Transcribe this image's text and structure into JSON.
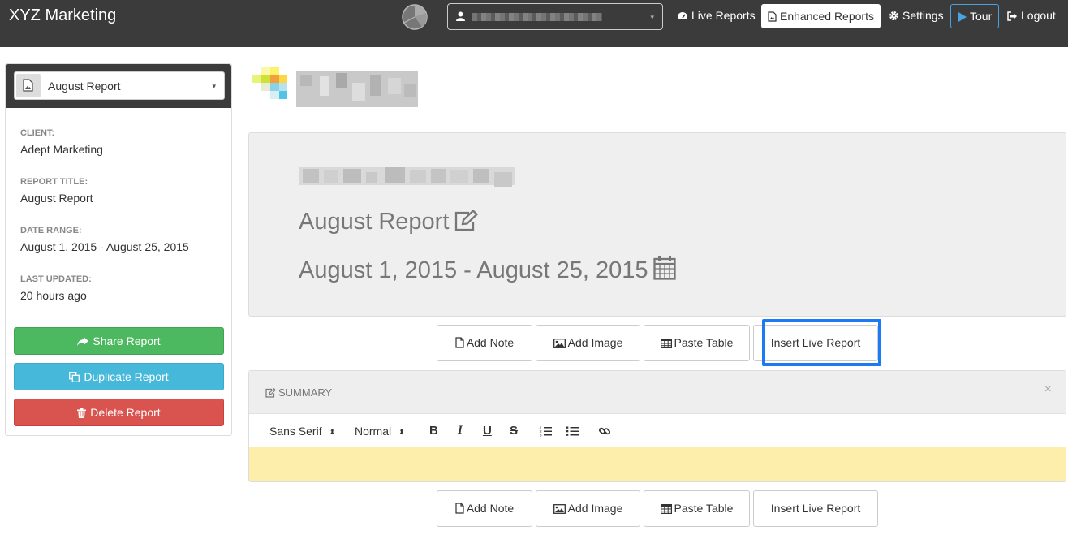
{
  "navbar": {
    "brand": "XYZ Marketing",
    "account_select": {
      "caret": "▾"
    },
    "links": {
      "live_reports": "Live Reports",
      "enhanced_reports": "Enhanced Reports",
      "settings": "Settings",
      "tour": "Tour",
      "logout": "Logout"
    }
  },
  "sidebar": {
    "report_select": {
      "value": "August Report",
      "caret": "▾"
    },
    "meta": [
      {
        "key": "CLIENT:",
        "value": "Adept Marketing"
      },
      {
        "key": "REPORT TITLE:",
        "value": "August Report"
      },
      {
        "key": "DATE RANGE:",
        "value": "August 1, 2015 - August 25, 2015"
      },
      {
        "key": "LAST UPDATED:",
        "value": "20 hours ago"
      }
    ],
    "buttons": {
      "share": "Share Report",
      "duplicate": "Duplicate Report",
      "delete": "Delete Report"
    }
  },
  "header": {
    "title": "August Report",
    "date_range": "August 1, 2015 - August 25, 2015"
  },
  "toolbar_top": {
    "add_note": "Add Note",
    "add_image": "Add Image",
    "paste_table": "Paste Table",
    "insert_live_report": "Insert Live Report"
  },
  "summary": {
    "title": "SUMMARY",
    "close": "×",
    "editor": {
      "font": "Sans Serif",
      "size": "Normal",
      "updown": "⬍",
      "bold": "B",
      "italic": "I",
      "underline": "U",
      "strike": "S"
    }
  },
  "toolbar_bottom": {
    "add_note": "Add Note",
    "add_image": "Add Image",
    "paste_table": "Paste Table",
    "insert_live_report": "Insert Live Report"
  },
  "colors": {
    "navbar": "#3b3b3b",
    "share": "#4cb860",
    "duplicate": "#46b8da",
    "delete": "#d9534f",
    "highlight": "#1a7bf2",
    "editor_bg": "#feeeab"
  },
  "icons": [
    "user-icon",
    "dashboard-icon",
    "file-image-icon",
    "gear-icon",
    "play-icon",
    "logout-icon",
    "share-icon",
    "copy-icon",
    "trash-icon",
    "edit-icon",
    "calendar-icon",
    "file-icon",
    "picture-icon",
    "table-icon",
    "ordered-list-icon",
    "bullet-list-icon",
    "link-icon"
  ]
}
